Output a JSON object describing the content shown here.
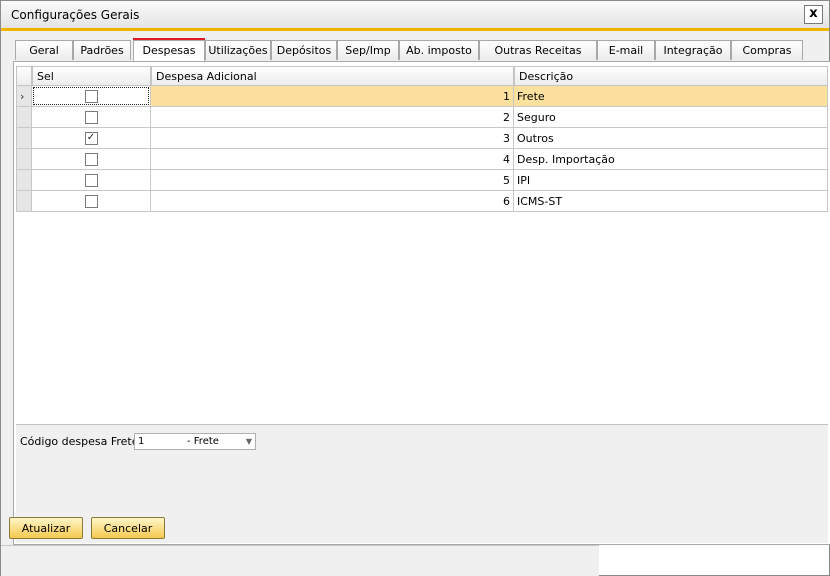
{
  "window": {
    "title": "Configurações Gerais",
    "close_label": "x"
  },
  "tabs": [
    {
      "label": "Geral"
    },
    {
      "label": "Padrões"
    },
    {
      "label": "Despesas",
      "active": true
    },
    {
      "label": "Utilizações"
    },
    {
      "label": "Depósitos"
    },
    {
      "label": "Sep/Imp"
    },
    {
      "label": "Ab. imposto"
    },
    {
      "label": "Outras Receitas"
    },
    {
      "label": "E-mail"
    },
    {
      "label": "Integração"
    },
    {
      "label": "Compras"
    }
  ],
  "grid": {
    "columns": {
      "sel": "Sel",
      "despesa": "Despesa Adicional",
      "descricao": "Descrição"
    },
    "rows": [
      {
        "checked": false,
        "despesa": "1",
        "descricao": "Frete",
        "selected": true
      },
      {
        "checked": false,
        "despesa": "2",
        "descricao": "Seguro"
      },
      {
        "checked": true,
        "despesa": "3",
        "descricao": "Outros"
      },
      {
        "checked": false,
        "despesa": "4",
        "descricao": "Desp. Importação"
      },
      {
        "checked": false,
        "despesa": "5",
        "descricao": "IPI"
      },
      {
        "checked": false,
        "despesa": "6",
        "descricao": "ICMS-ST"
      }
    ]
  },
  "frete_field": {
    "label": "Código despesa Frete",
    "code": "1",
    "name": "- Frete"
  },
  "buttons": {
    "update": "Atualizar",
    "cancel": "Cancelar"
  },
  "colors": {
    "accent": "#f0b400",
    "selected_row": "#fbe19d",
    "highlight": "#e11b22"
  }
}
